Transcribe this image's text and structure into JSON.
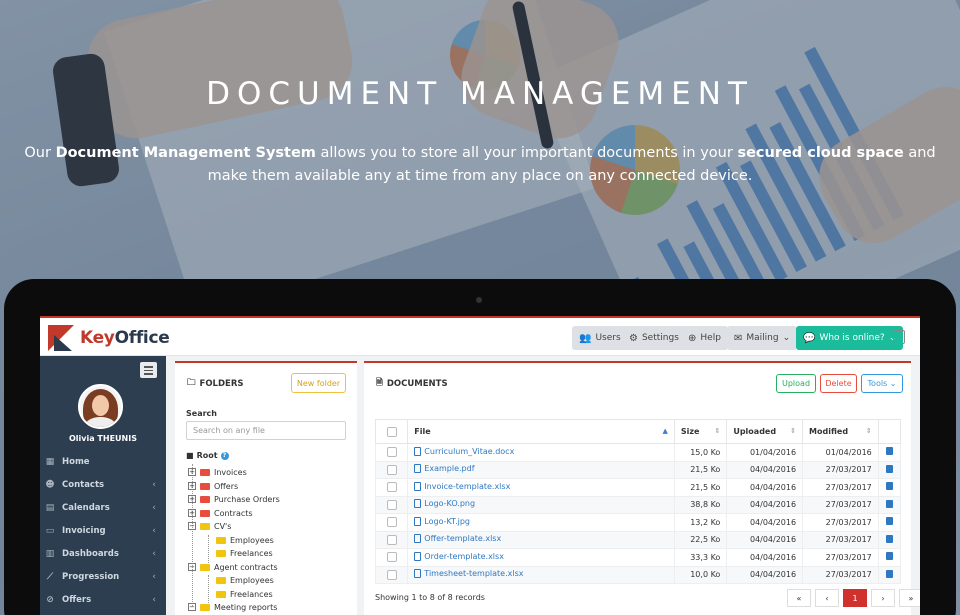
{
  "hero": {
    "headline": "DOCUMENT MANAGEMENT",
    "tagline_pre": "Our ",
    "tagline_bold1": "Document Management System",
    "tagline_mid": " allows you to store all your important documents in your ",
    "tagline_bold2": "secured cloud space",
    "tagline_post": " and make them available any at time from any place on any connected device."
  },
  "app": {
    "logo_key": "Key",
    "logo_office": "Office",
    "topbar": {
      "users": "Users",
      "settings": "Settings",
      "help": "Help",
      "mailing": "Mailing",
      "who_online": "Who is online?"
    },
    "sidebar": {
      "user_name": "Olivia THEUNIS",
      "items": [
        {
          "label": "Home",
          "icon": "grid-icon"
        },
        {
          "label": "Contacts",
          "icon": "contacts-icon"
        },
        {
          "label": "Calendars",
          "icon": "calendar-icon"
        },
        {
          "label": "Invoicing",
          "icon": "invoice-icon"
        },
        {
          "label": "Dashboards",
          "icon": "bar-chart-icon"
        },
        {
          "label": "Progression",
          "icon": "line-chart-icon"
        },
        {
          "label": "Offers",
          "icon": "tag-icon"
        }
      ]
    },
    "folders": {
      "title": "FOLDERS",
      "new_folder": "New folder",
      "search_label": "Search",
      "search_placeholder": "Search on any file",
      "root": "Root",
      "tree": [
        "Invoices",
        "Offers",
        "Purchase Orders",
        "Contracts",
        "CV's",
        "Employees",
        "Freelances",
        "Agent contracts",
        "Employees",
        "Freelances",
        "Meeting reports"
      ]
    },
    "documents": {
      "title": "DOCUMENTS",
      "upload": "Upload",
      "delete": "Delete",
      "tools": "Tools",
      "columns": {
        "file": "File",
        "size": "Size",
        "uploaded": "Uploaded",
        "modified": "Modified"
      },
      "rows": [
        {
          "file": "Curriculum_Vitae.docx",
          "size": "15,0 Ko",
          "uploaded": "01/04/2016",
          "modified": "01/04/2016"
        },
        {
          "file": "Example.pdf",
          "size": "21,5 Ko",
          "uploaded": "04/04/2016",
          "modified": "27/03/2017"
        },
        {
          "file": "Invoice-template.xlsx",
          "size": "21,5 Ko",
          "uploaded": "04/04/2016",
          "modified": "27/03/2017"
        },
        {
          "file": "Logo-KO.png",
          "size": "38,8 Ko",
          "uploaded": "04/04/2016",
          "modified": "27/03/2017"
        },
        {
          "file": "Logo-KT.jpg",
          "size": "13,2 Ko",
          "uploaded": "04/04/2016",
          "modified": "27/03/2017"
        },
        {
          "file": "Offer-template.xlsx",
          "size": "22,5 Ko",
          "uploaded": "04/04/2016",
          "modified": "27/03/2017"
        },
        {
          "file": "Order-template.xlsx",
          "size": "33,3 Ko",
          "uploaded": "04/04/2016",
          "modified": "27/03/2017"
        },
        {
          "file": "Timesheet-template.xlsx",
          "size": "10,0 Ko",
          "uploaded": "04/04/2016",
          "modified": "27/03/2017"
        }
      ],
      "showing": "Showing 1 to 8 of 8 records",
      "pager": {
        "first": "«",
        "prev": "‹",
        "page": "1",
        "next": "›",
        "last": "»"
      }
    }
  },
  "colors": {
    "accent": "#c0392b",
    "sidebar": "#2c3e50",
    "link": "#2e78c2",
    "green": "#1abc9c"
  }
}
